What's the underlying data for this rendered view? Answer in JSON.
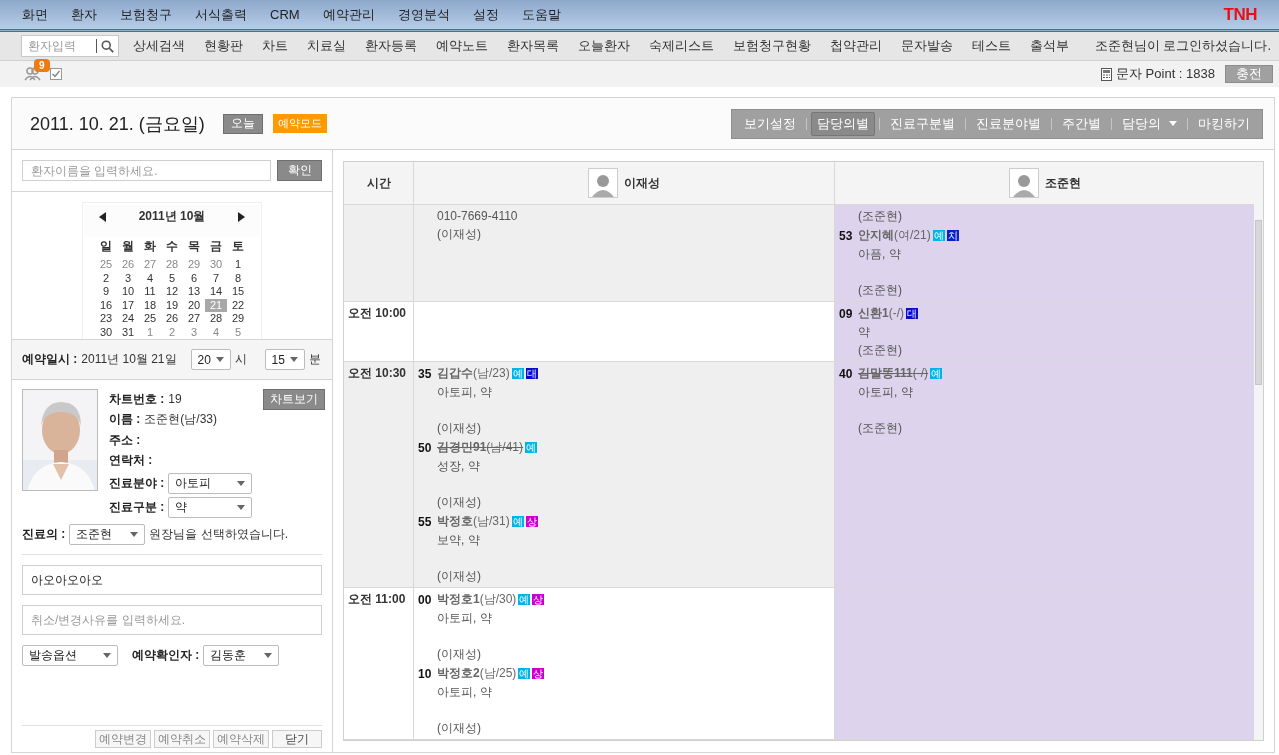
{
  "menu": {
    "items": [
      "화면",
      "환자",
      "보험청구",
      "서식출력",
      "CRM",
      "예약관리",
      "경영분석",
      "설정",
      "도움말"
    ],
    "logo": "TNH"
  },
  "nav": {
    "search_placeholder": "환자입력",
    "items": [
      "상세검색",
      "현황판",
      "차트",
      "치료실",
      "환자등록",
      "예약노트",
      "환자목록",
      "오늘환자",
      "숙제리스트",
      "보험청구현황",
      "첩약관리",
      "문자발송",
      "테스트",
      "출석부"
    ],
    "login": "조준현님이 로그인하셨습니다."
  },
  "toolbar": {
    "badge": "9",
    "sms_label": "문자 Point : 1838",
    "charge": "충전"
  },
  "header": {
    "date": "2011. 10. 21. (금요일)",
    "today": "오늘",
    "mode": "예약모드",
    "views": [
      {
        "label": "보기설정",
        "kind": "tab",
        "selected": false
      },
      {
        "label": "담당의별",
        "kind": "tab",
        "selected": true
      },
      {
        "label": "진료구분별",
        "kind": "tab",
        "selected": false
      },
      {
        "label": "진료분야별",
        "kind": "tab",
        "selected": false
      },
      {
        "label": "주간별",
        "kind": "tab",
        "selected": false
      },
      {
        "label": "담당의",
        "kind": "dropdown",
        "selected": false
      },
      {
        "label": "마킹하기",
        "kind": "tab",
        "selected": false
      }
    ]
  },
  "patient_search": {
    "placeholder": "환자이름을 입력하세요.",
    "button": "확인"
  },
  "calendar": {
    "title": "2011년 10월",
    "weekdays": [
      "일",
      "월",
      "화",
      "수",
      "목",
      "금",
      "토"
    ],
    "weeks": [
      [
        {
          "d": "25",
          "other_month": true,
          "selected": false
        },
        {
          "d": "26",
          "other_month": true,
          "selected": false
        },
        {
          "d": "27",
          "other_month": true,
          "selected": false
        },
        {
          "d": "28",
          "other_month": true,
          "selected": false
        },
        {
          "d": "29",
          "other_month": true,
          "selected": false
        },
        {
          "d": "30",
          "other_month": true,
          "selected": false
        },
        {
          "d": "1",
          "other_month": false,
          "selected": false
        }
      ],
      [
        {
          "d": "2",
          "other_month": false,
          "selected": false
        },
        {
          "d": "3",
          "other_month": false,
          "selected": false
        },
        {
          "d": "4",
          "other_month": false,
          "selected": false
        },
        {
          "d": "5",
          "other_month": false,
          "selected": false
        },
        {
          "d": "6",
          "other_month": false,
          "selected": false
        },
        {
          "d": "7",
          "other_month": false,
          "selected": false
        },
        {
          "d": "8",
          "other_month": false,
          "selected": false
        }
      ],
      [
        {
          "d": "9",
          "other_month": false,
          "selected": false
        },
        {
          "d": "10",
          "other_month": false,
          "selected": false
        },
        {
          "d": "11",
          "other_month": false,
          "selected": false
        },
        {
          "d": "12",
          "other_month": false,
          "selected": false
        },
        {
          "d": "13",
          "other_month": false,
          "selected": false
        },
        {
          "d": "14",
          "other_month": false,
          "selected": false
        },
        {
          "d": "15",
          "other_month": false,
          "selected": false
        }
      ],
      [
        {
          "d": "16",
          "other_month": false,
          "selected": false
        },
        {
          "d": "17",
          "other_month": false,
          "selected": false
        },
        {
          "d": "18",
          "other_month": false,
          "selected": false
        },
        {
          "d": "19",
          "other_month": false,
          "selected": false
        },
        {
          "d": "20",
          "other_month": false,
          "selected": false
        },
        {
          "d": "21",
          "other_month": false,
          "selected": true
        },
        {
          "d": "22",
          "other_month": false,
          "selected": false
        }
      ],
      [
        {
          "d": "23",
          "other_month": false,
          "selected": false
        },
        {
          "d": "24",
          "other_month": false,
          "selected": false
        },
        {
          "d": "25",
          "other_month": false,
          "selected": false
        },
        {
          "d": "26",
          "other_month": false,
          "selected": false
        },
        {
          "d": "27",
          "other_month": false,
          "selected": false
        },
        {
          "d": "28",
          "other_month": false,
          "selected": false
        },
        {
          "d": "29",
          "other_month": false,
          "selected": false
        }
      ],
      [
        {
          "d": "30",
          "other_month": false,
          "selected": false
        },
        {
          "d": "31",
          "other_month": false,
          "selected": false
        },
        {
          "d": "1",
          "other_month": true,
          "selected": false
        },
        {
          "d": "2",
          "other_month": true,
          "selected": false
        },
        {
          "d": "3",
          "other_month": true,
          "selected": false
        },
        {
          "d": "4",
          "other_month": true,
          "selected": false
        },
        {
          "d": "5",
          "other_month": true,
          "selected": false
        }
      ]
    ]
  },
  "reservation_time": {
    "label": "예약일시 :",
    "date": "2011년 10월 21일",
    "hour": "20",
    "hour_unit": "시",
    "minute": "15",
    "minute_unit": "분"
  },
  "patient": {
    "chart_button": "차트보기",
    "fields": [
      {
        "label": "차트번호 :",
        "kind": "text",
        "value": "19"
      },
      {
        "label": "이름 :",
        "kind": "text",
        "value": "조준현(남/33)"
      },
      {
        "label": "주소 :",
        "kind": "text"
      },
      {
        "label": "연락처 :",
        "kind": "text"
      },
      {
        "label": "진료분야 :",
        "kind": "select",
        "value": "아토피"
      },
      {
        "label": "진료구분 :",
        "kind": "select",
        "value": "약"
      }
    ]
  },
  "doctor": {
    "label": "진료의 :",
    "value": "조준현",
    "suffix": "원장님을 선택하였습니다."
  },
  "memo": {
    "value": "아오아오아오"
  },
  "reason": {
    "placeholder": "취소/변경사유를 입력하세요."
  },
  "send_option": "발송옵션",
  "confirmer": {
    "label": "예약확인자 :",
    "value": "김동훈"
  },
  "actions": [
    {
      "label": "예약변경",
      "disabled": true
    },
    {
      "label": "예약취소",
      "disabled": true
    },
    {
      "label": "예약삭제",
      "disabled": true
    },
    {
      "label": "닫기",
      "disabled": false
    }
  ],
  "schedule": {
    "time_heading": "시간",
    "doctors": [
      {
        "name": "이재성",
        "highlighted": false
      },
      {
        "name": "조준현",
        "highlighted": true
      }
    ],
    "rows": [
      {
        "shaded": true,
        "cells": [
          {
            "entries": [
              {
                "kind": "note",
                "lines": [
                  "010-7669-4110",
                  "(이재성)"
                ]
              }
            ]
          },
          {
            "entries": [
              {
                "kind": "note",
                "lines": [
                  "(조준현)"
                ]
              },
              {
                "kind": "appointment",
                "minute": "53",
                "name": "안지혜",
                "detail": "(여/21)",
                "struck": false,
                "tags": [
                  {
                    "label": "예",
                    "color": "#00b4e6"
                  },
                  {
                    "label": "치",
                    "color": "#0a1ecc"
                  }
                ],
                "treatment": "아픔, 약",
                "gap": true,
                "doctor": "(조준현)"
              }
            ]
          }
        ]
      },
      {
        "time": "오전 10:00",
        "shaded": false,
        "cells": [
          {},
          {
            "entries": [
              {
                "kind": "appointment",
                "minute": "09",
                "name": "신환1",
                "detail": "(-/)",
                "struck": false,
                "tags": [
                  {
                    "label": "대",
                    "color": "#0a0acc"
                  }
                ],
                "treatment": "약",
                "gap": false,
                "doctor": "(조준현)"
              }
            ]
          }
        ]
      },
      {
        "time": "오전 10:30",
        "shaded": true,
        "cells": [
          {
            "entries": [
              {
                "kind": "appointment",
                "minute": "35",
                "name": "김갑수",
                "detail": "(남/23)",
                "struck": false,
                "tags": [
                  {
                    "label": "예",
                    "color": "#00b4e6"
                  },
                  {
                    "label": "대",
                    "color": "#0a0acc"
                  }
                ],
                "treatment": "아토피, 약",
                "gap": true,
                "doctor": "(이재성)"
              },
              {
                "kind": "appointment",
                "minute": "50",
                "name": "김경민91",
                "detail": "(남/41)",
                "struck": true,
                "tags": [
                  {
                    "label": "예",
                    "color": "#00b4e6"
                  }
                ],
                "treatment": "성장, 약",
                "gap": true,
                "doctor": "(이재성)"
              },
              {
                "kind": "appointment",
                "minute": "55",
                "name": "박정호",
                "detail": "(남/31)",
                "struck": false,
                "tags": [
                  {
                    "label": "예",
                    "color": "#00b4e6"
                  },
                  {
                    "label": "상",
                    "color": "#cc00cc"
                  }
                ],
                "treatment": "보약, 약",
                "gap": true,
                "doctor": "(이재성)"
              }
            ]
          },
          {
            "entries": [
              {
                "kind": "appointment",
                "minute": "40",
                "name": "김말똥111",
                "detail": "(-/)",
                "struck": true,
                "tags": [
                  {
                    "label": "예",
                    "color": "#00b4e6"
                  }
                ],
                "treatment": "아토피, 약",
                "gap": true,
                "doctor": "(조준현)"
              }
            ]
          }
        ]
      },
      {
        "time": "오전 11:00",
        "shaded": false,
        "cells": [
          {
            "entries": [
              {
                "kind": "appointment",
                "minute": "00",
                "name": "박정호1",
                "detail": "(남/30)",
                "struck": false,
                "tags": [
                  {
                    "label": "예",
                    "color": "#00b4e6"
                  },
                  {
                    "label": "상",
                    "color": "#cc00cc"
                  }
                ],
                "treatment": "아토피, 약",
                "gap": true,
                "doctor": "(이재성)"
              },
              {
                "kind": "appointment",
                "minute": "10",
                "name": "박정호2",
                "detail": "(남/25)",
                "struck": false,
                "tags": [
                  {
                    "label": "예",
                    "color": "#00b4e6"
                  },
                  {
                    "label": "상",
                    "color": "#cc00cc"
                  }
                ],
                "treatment": "아토피, 약",
                "gap": true,
                "doctor": "(이재성)"
              }
            ]
          },
          {}
        ]
      }
    ]
  }
}
